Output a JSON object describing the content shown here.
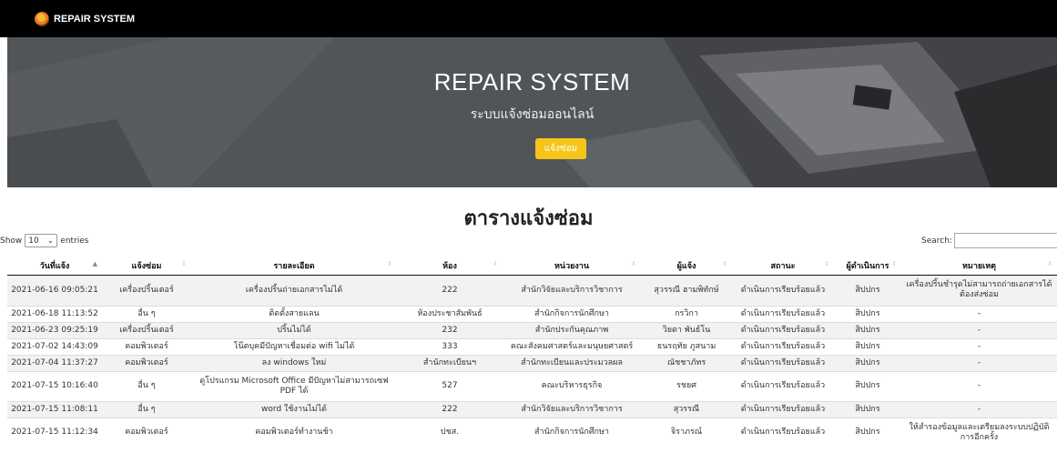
{
  "navbar": {
    "brand": "REPAIR SYSTEM"
  },
  "hero": {
    "title": "REPAIR SYSTEM",
    "subtitle": "ระบบแจ้งซ่อมออนไลน์",
    "button": "แจ้งซ่อม"
  },
  "table_section": {
    "title": "ตารางแจ้งซ่อม",
    "show_label": "Show",
    "entries_label": "entries",
    "page_length": "10",
    "search_label": "Search:",
    "search_value": ""
  },
  "columns": [
    "วันที่แจ้ง",
    "แจ้งซ่อม",
    "รายละเอียด",
    "ห้อง",
    "หน่วยงาน",
    "ผู้แจ้ง",
    "สถานะ",
    "ผู้ดำเนินการ",
    "หมายเหตุ"
  ],
  "rows": [
    [
      "2021-06-16 09:05:21",
      "เครื่องปริ้นเตอร์",
      "เครื่องปริ้นถ่ายเอกสารไม่ได้",
      "222",
      "สำนักวิจัยและบริการวิชาการ",
      "สุวรรณี ฮามพิทักษ์",
      "ดำเนินการเรียบร้อยแล้ว",
      "สิปปกร",
      "เครื่องปริ้นชำรุดไม่สามารถถ่ายเอกสารได้ ต้องส่งซ่อม"
    ],
    [
      "2021-06-18 11:13:52",
      "อื่น ๆ",
      "ติดตั้งสายแลน",
      "ห้องประชาสัมพันธ์",
      "สำนักกิจการนักศึกษา",
      "กรวิกา",
      "ดำเนินการเรียบร้อยแล้ว",
      "สิปปกร",
      "-"
    ],
    [
      "2021-06-23 09:25:19",
      "เครื่องปริ้นเตอร์",
      "ปริ้นไม่ได้",
      "232",
      "สำนักประกันคุณภาพ",
      "วิยดา พันธ์โน",
      "ดำเนินการเรียบร้อยแล้ว",
      "สิปปกร",
      "-"
    ],
    [
      "2021-07-02 14:43:09",
      "คอมพิวเตอร์",
      "โน๊ตบุคมีปัญหาเชื่อมต่อ wifi ไม่ได้",
      "333",
      "คณะสังคมศาสตร์และมนุษยศาสตร์",
      "ธนรฤทัย ภูสนาม",
      "ดำเนินการเรียบร้อยแล้ว",
      "สิปปกร",
      "-"
    ],
    [
      "2021-07-04 11:37:27",
      "คอมพิวเตอร์",
      "ลง windows ใหม่",
      "สำนักทะเบียนฯ",
      "สำนักทะเบียนและประมวลผล",
      "ณัชชาภัทร",
      "ดำเนินการเรียบร้อยแล้ว",
      "สิปปกร",
      "-"
    ],
    [
      "2021-07-15 10:16:40",
      "อื่น ๆ",
      "ดูโปรแกรม Microsoft Office มีปัญหาไม่สามารถเซฟ PDF ได้",
      "527",
      "คณะบริหารธุรกิจ",
      "รชยศ",
      "ดำเนินการเรียบร้อยแล้ว",
      "สิปปกร",
      "-"
    ],
    [
      "2021-07-15 11:08:11",
      "อื่น ๆ",
      "word ใช้งานไม่ได้",
      "222",
      "สำนักวิจัยและบริการวิชาการ",
      "สุวรรณี",
      "ดำเนินการเรียบร้อยแล้ว",
      "สิปปกร",
      "-"
    ],
    [
      "2021-07-15 11:12:34",
      "คอมพิวเตอร์",
      "คอมพิวเตอร์ทำงานช้า",
      "ปชส.",
      "สำนักกิจการนักศึกษา",
      "จิราภรณ์",
      "ดำเนินการเรียบร้อยแล้ว",
      "สิปปกร",
      "ให้สำรองข้อมูลและเตรียมลงระบบปฏิบัติการอีกครั้ง"
    ]
  ]
}
